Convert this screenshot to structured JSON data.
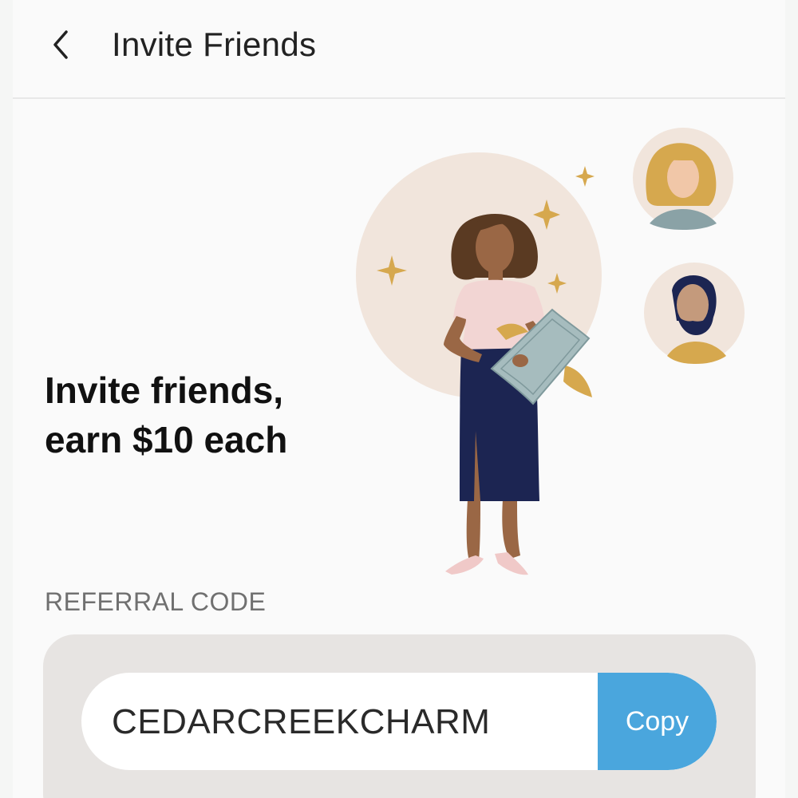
{
  "header": {
    "back_icon": "chevron-left-icon",
    "title": "Invite Friends"
  },
  "hero": {
    "line1": "Invite friends,",
    "line2": "earn $10 each"
  },
  "referral": {
    "label": "REFERRAL CODE",
    "code": "CEDARCREEKCHARM",
    "copy_label": "Copy"
  },
  "colors": {
    "accent": "#4aa6dd",
    "panel": "#e7e4e2",
    "circle": "#f1e5dc",
    "skirt": "#1c2552",
    "gold": "#d6a84e"
  }
}
